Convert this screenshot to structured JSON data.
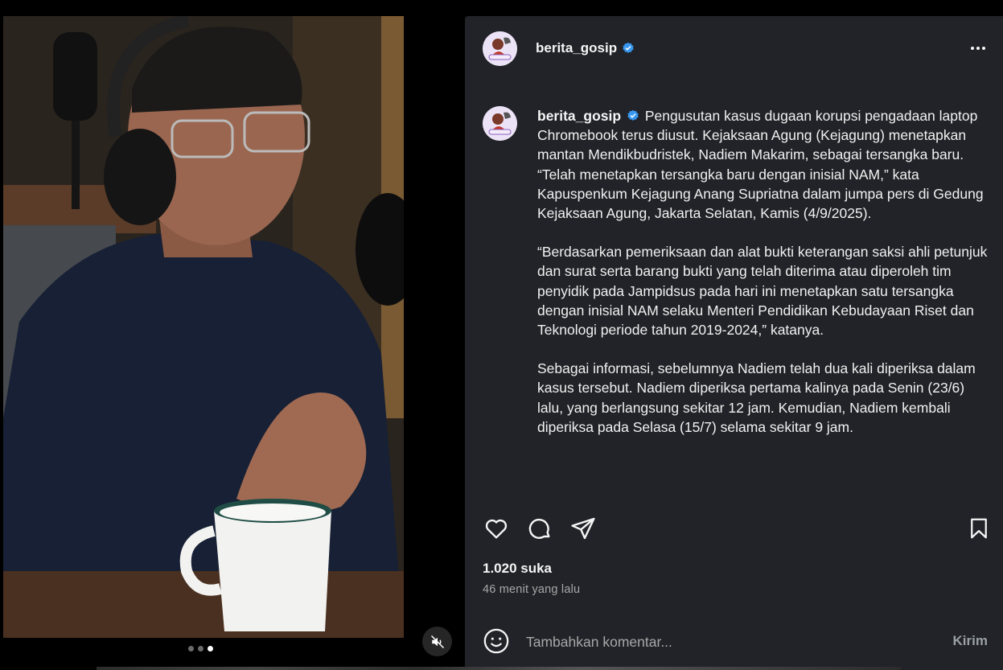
{
  "post": {
    "username": "berita_gosip",
    "verified": true,
    "avatar_label": "beritagosip",
    "more_options_icon": "more-horizontal-icon"
  },
  "caption": {
    "username": "berita_gosip",
    "paragraphs": [
      "Pengusutan kasus dugaan korupsi pengadaan laptop Chromebook terus diusut. Kejaksaan Agung (Kejagung) menetapkan mantan Mendikbudristek, Nadiem Makarim, sebagai tersangka baru.",
      "“Telah menetapkan tersangka baru dengan inisial NAM,” kata Kapuspenkum Kejagung Anang Supriatna dalam jumpa pers di Gedung Kejaksaan Agung, Jakarta Selatan, Kamis (4/9/2025).",
      "“Berdasarkan pemeriksaan dan alat bukti keterangan saksi ahli petunjuk dan surat serta barang bukti yang telah diterima atau diperoleh tim penyidik pada Jampidsus pada hari ini menetapkan satu tersangka dengan inisial NAM selaku Menteri Pendidikan Kebudayaan Riset dan Teknologi periode tahun 2019-2024,” katanya.",
      "Sebagai informasi, sebelumnya Nadiem telah dua kali diperiksa dalam kasus tersebut. Nadiem diperiksa pertama kalinya pada Senin (23/6) lalu, yang berlangsung sekitar 12 jam. Kemudian, Nadiem kembali diperiksa pada Selasa (15/7) selama sekitar 9 jam."
    ]
  },
  "engagement": {
    "likes": "1.020 suka",
    "time_ago": "46 menit yang lalu"
  },
  "comment": {
    "placeholder": "Tambahkan komentar...",
    "send_label": "Kirim"
  },
  "media": {
    "carousel_total": 3,
    "carousel_active": 3,
    "mute_icon": "muted-speaker-icon"
  },
  "colors": {
    "panel_bg": "#212328",
    "verified_blue": "#3897f0",
    "page_bg": "#000000"
  }
}
